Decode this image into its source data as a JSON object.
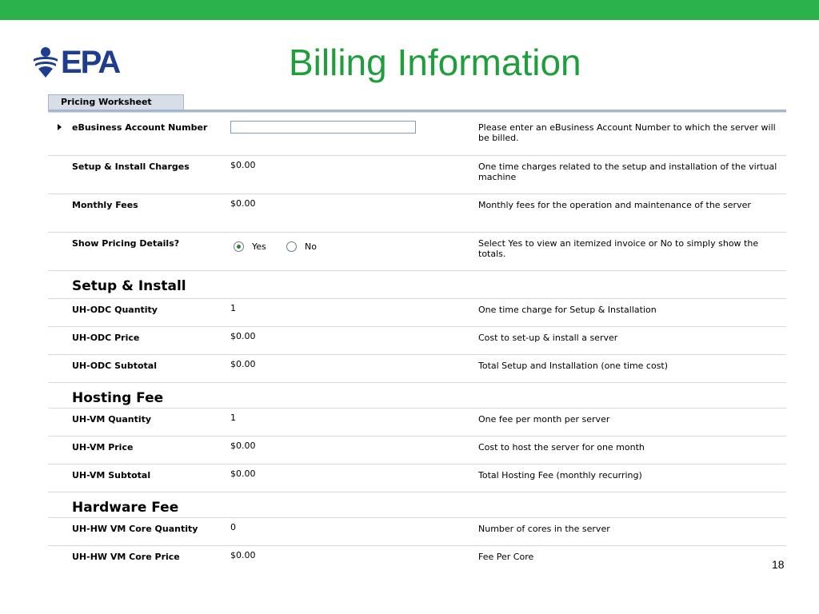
{
  "logo": {
    "text": "EPA"
  },
  "slide": {
    "title": "Billing Information",
    "page_number": "18"
  },
  "tab": {
    "label": "Pricing Worksheet"
  },
  "account": {
    "label": "eBusiness Account Number",
    "value": "",
    "description": "Please enter an eBusiness Account Number to which the server will be billed."
  },
  "setup_charges": {
    "label": "Setup & Install Charges",
    "value": "$0.00",
    "description": "One time charges related to the setup and installation of the virtual machine"
  },
  "monthly_fees": {
    "label": "Monthly Fees",
    "value": "$0.00",
    "description": "Monthly fees for the operation and maintenance of the server"
  },
  "pricing_details": {
    "label": "Show Pricing Details?",
    "yes_label": "Yes",
    "no_label": "No",
    "selected": "Yes",
    "description": "Select Yes to view an itemized invoice or No to simply show the totals."
  },
  "setup_section": {
    "title": "Setup & Install",
    "rows": [
      {
        "label": "UH-ODC Quantity",
        "value": "1",
        "description": "One time charge for Setup & Installation"
      },
      {
        "label": "UH-ODC Price",
        "value": "$0.00",
        "description": "Cost to set-up & install a server"
      },
      {
        "label": "UH-ODC Subtotal",
        "value": "$0.00",
        "description": "Total Setup and Installation (one time cost)"
      }
    ]
  },
  "hosting_section": {
    "title": "Hosting Fee",
    "rows": [
      {
        "label": "UH-VM Quantity",
        "value": "1",
        "description": "One fee per month per server"
      },
      {
        "label": "UH-VM Price",
        "value": "$0.00",
        "description": "Cost to host the server for one month"
      },
      {
        "label": "UH-VM Subtotal",
        "value": "$0.00",
        "description": "Total Hosting Fee (monthly recurring)"
      }
    ]
  },
  "hardware_section": {
    "title": "Hardware Fee",
    "rows": [
      {
        "label": "UH-HW VM Core Quantity",
        "value": "0",
        "description": "Number of cores in the server"
      },
      {
        "label": "UH-HW VM Core Price",
        "value": "$0.00",
        "description": "Fee Per Core"
      }
    ]
  },
  "colors": {
    "green_bar": "#2bb24c",
    "title_green": "#1f9e3b",
    "epa_blue": "#1f3d8f"
  }
}
